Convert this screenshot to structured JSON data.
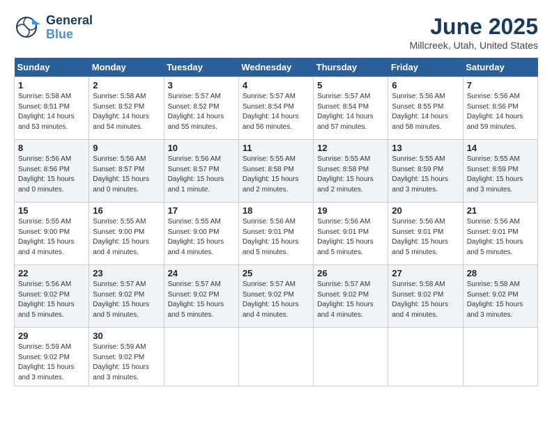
{
  "header": {
    "logo_general": "General",
    "logo_blue": "Blue",
    "month_title": "June 2025",
    "location": "Millcreek, Utah, United States"
  },
  "calendar": {
    "days_of_week": [
      "Sunday",
      "Monday",
      "Tuesday",
      "Wednesday",
      "Thursday",
      "Friday",
      "Saturday"
    ],
    "weeks": [
      [
        null,
        {
          "day": "2",
          "sunrise": "Sunrise: 5:58 AM",
          "sunset": "Sunset: 8:52 PM",
          "daylight": "Daylight: 14 hours and 54 minutes."
        },
        {
          "day": "3",
          "sunrise": "Sunrise: 5:57 AM",
          "sunset": "Sunset: 8:52 PM",
          "daylight": "Daylight: 14 hours and 55 minutes."
        },
        {
          "day": "4",
          "sunrise": "Sunrise: 5:57 AM",
          "sunset": "Sunset: 8:54 PM",
          "daylight": "Daylight: 14 hours and 56 minutes."
        },
        {
          "day": "5",
          "sunrise": "Sunrise: 5:57 AM",
          "sunset": "Sunset: 8:54 PM",
          "daylight": "Daylight: 14 hours and 57 minutes."
        },
        {
          "day": "6",
          "sunrise": "Sunrise: 5:56 AM",
          "sunset": "Sunset: 8:55 PM",
          "daylight": "Daylight: 14 hours and 58 minutes."
        },
        {
          "day": "7",
          "sunrise": "Sunrise: 5:56 AM",
          "sunset": "Sunset: 8:56 PM",
          "daylight": "Daylight: 14 hours and 59 minutes."
        }
      ],
      [
        {
          "day": "1",
          "sunrise": "Sunrise: 5:58 AM",
          "sunset": "Sunset: 8:51 PM",
          "daylight": "Daylight: 14 hours and 53 minutes."
        },
        null,
        null,
        null,
        null,
        null,
        null
      ],
      [
        {
          "day": "8",
          "sunrise": "Sunrise: 5:56 AM",
          "sunset": "Sunset: 8:56 PM",
          "daylight": "Daylight: 15 hours and 0 minutes."
        },
        {
          "day": "9",
          "sunrise": "Sunrise: 5:56 AM",
          "sunset": "Sunset: 8:57 PM",
          "daylight": "Daylight: 15 hours and 0 minutes."
        },
        {
          "day": "10",
          "sunrise": "Sunrise: 5:56 AM",
          "sunset": "Sunset: 8:57 PM",
          "daylight": "Daylight: 15 hours and 1 minute."
        },
        {
          "day": "11",
          "sunrise": "Sunrise: 5:55 AM",
          "sunset": "Sunset: 8:58 PM",
          "daylight": "Daylight: 15 hours and 2 minutes."
        },
        {
          "day": "12",
          "sunrise": "Sunrise: 5:55 AM",
          "sunset": "Sunset: 8:58 PM",
          "daylight": "Daylight: 15 hours and 2 minutes."
        },
        {
          "day": "13",
          "sunrise": "Sunrise: 5:55 AM",
          "sunset": "Sunset: 8:59 PM",
          "daylight": "Daylight: 15 hours and 3 minutes."
        },
        {
          "day": "14",
          "sunrise": "Sunrise: 5:55 AM",
          "sunset": "Sunset: 8:59 PM",
          "daylight": "Daylight: 15 hours and 3 minutes."
        }
      ],
      [
        {
          "day": "15",
          "sunrise": "Sunrise: 5:55 AM",
          "sunset": "Sunset: 9:00 PM",
          "daylight": "Daylight: 15 hours and 4 minutes."
        },
        {
          "day": "16",
          "sunrise": "Sunrise: 5:55 AM",
          "sunset": "Sunset: 9:00 PM",
          "daylight": "Daylight: 15 hours and 4 minutes."
        },
        {
          "day": "17",
          "sunrise": "Sunrise: 5:55 AM",
          "sunset": "Sunset: 9:00 PM",
          "daylight": "Daylight: 15 hours and 4 minutes."
        },
        {
          "day": "18",
          "sunrise": "Sunrise: 5:56 AM",
          "sunset": "Sunset: 9:01 PM",
          "daylight": "Daylight: 15 hours and 5 minutes."
        },
        {
          "day": "19",
          "sunrise": "Sunrise: 5:56 AM",
          "sunset": "Sunset: 9:01 PM",
          "daylight": "Daylight: 15 hours and 5 minutes."
        },
        {
          "day": "20",
          "sunrise": "Sunrise: 5:56 AM",
          "sunset": "Sunset: 9:01 PM",
          "daylight": "Daylight: 15 hours and 5 minutes."
        },
        {
          "day": "21",
          "sunrise": "Sunrise: 5:56 AM",
          "sunset": "Sunset: 9:01 PM",
          "daylight": "Daylight: 15 hours and 5 minutes."
        }
      ],
      [
        {
          "day": "22",
          "sunrise": "Sunrise: 5:56 AM",
          "sunset": "Sunset: 9:02 PM",
          "daylight": "Daylight: 15 hours and 5 minutes."
        },
        {
          "day": "23",
          "sunrise": "Sunrise: 5:57 AM",
          "sunset": "Sunset: 9:02 PM",
          "daylight": "Daylight: 15 hours and 5 minutes."
        },
        {
          "day": "24",
          "sunrise": "Sunrise: 5:57 AM",
          "sunset": "Sunset: 9:02 PM",
          "daylight": "Daylight: 15 hours and 5 minutes."
        },
        {
          "day": "25",
          "sunrise": "Sunrise: 5:57 AM",
          "sunset": "Sunset: 9:02 PM",
          "daylight": "Daylight: 15 hours and 4 minutes."
        },
        {
          "day": "26",
          "sunrise": "Sunrise: 5:57 AM",
          "sunset": "Sunset: 9:02 PM",
          "daylight": "Daylight: 15 hours and 4 minutes."
        },
        {
          "day": "27",
          "sunrise": "Sunrise: 5:58 AM",
          "sunset": "Sunset: 9:02 PM",
          "daylight": "Daylight: 15 hours and 4 minutes."
        },
        {
          "day": "28",
          "sunrise": "Sunrise: 5:58 AM",
          "sunset": "Sunset: 9:02 PM",
          "daylight": "Daylight: 15 hours and 3 minutes."
        }
      ],
      [
        {
          "day": "29",
          "sunrise": "Sunrise: 5:59 AM",
          "sunset": "Sunset: 9:02 PM",
          "daylight": "Daylight: 15 hours and 3 minutes."
        },
        {
          "day": "30",
          "sunrise": "Sunrise: 5:59 AM",
          "sunset": "Sunset: 9:02 PM",
          "daylight": "Daylight: 15 hours and 3 minutes."
        },
        null,
        null,
        null,
        null,
        null
      ]
    ]
  }
}
